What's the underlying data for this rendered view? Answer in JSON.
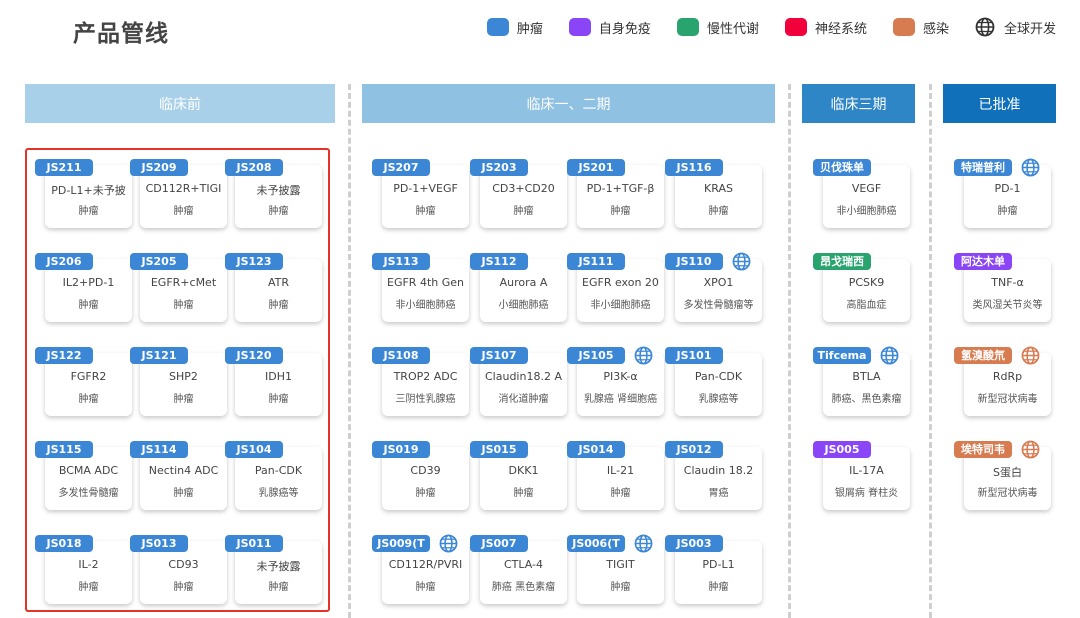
{
  "title": "产品管线",
  "colors": {
    "oncology": "#3b87d6",
    "autoimmune": "#8a45f7",
    "metabolic": "#2aa46e",
    "neuro": "#f2003c",
    "infection": "#d77c50",
    "highlight": "#e5332a",
    "preclinical": "#a9d0e9",
    "phase12": "#8fc1e2",
    "phase3": "#2f86c6",
    "approved": "#1071ba"
  },
  "legend": [
    {
      "label": "肿瘤",
      "color": "#3b87d6"
    },
    {
      "label": "自身免疫",
      "color": "#8a45f7"
    },
    {
      "label": "慢性代谢",
      "color": "#2aa46e"
    },
    {
      "label": "神经系统",
      "color": "#f2003c"
    },
    {
      "label": "感染",
      "color": "#d77c50"
    },
    {
      "label": "全球开发",
      "icon": "globe-icon"
    }
  ],
  "stages": [
    "临床前",
    "临床一、二期",
    "临床三期",
    "已批准"
  ],
  "columns": {
    "preclinical": [
      {
        "code": "JS211",
        "target": "PD-L1+未予披",
        "indication": "肿瘤",
        "color": "#3b87d6",
        "global": false
      },
      {
        "code": "JS209",
        "target": "CD112R+TIGI",
        "indication": "肿瘤",
        "color": "#3b87d6",
        "global": false
      },
      {
        "code": "JS208",
        "target": "未予披露",
        "indication": "肿瘤",
        "color": "#3b87d6",
        "global": false
      },
      {
        "code": "JS206",
        "target": "IL2+PD-1",
        "indication": "肿瘤",
        "color": "#3b87d6",
        "global": false
      },
      {
        "code": "JS205",
        "target": "EGFR+cMet",
        "indication": "肿瘤",
        "color": "#3b87d6",
        "global": false
      },
      {
        "code": "JS123",
        "target": "ATR",
        "indication": "肿瘤",
        "color": "#3b87d6",
        "global": false
      },
      {
        "code": "JS122",
        "target": "FGFR2",
        "indication": "肿瘤",
        "color": "#3b87d6",
        "global": false
      },
      {
        "code": "JS121",
        "target": "SHP2",
        "indication": "肿瘤",
        "color": "#3b87d6",
        "global": false
      },
      {
        "code": "JS120",
        "target": "IDH1",
        "indication": "肿瘤",
        "color": "#3b87d6",
        "global": false
      },
      {
        "code": "JS115",
        "target": "BCMA ADC",
        "indication": "多发性骨髓瘤",
        "color": "#3b87d6",
        "global": false
      },
      {
        "code": "JS114",
        "target": "Nectin4 ADC",
        "indication": "肿瘤",
        "color": "#3b87d6",
        "global": false
      },
      {
        "code": "JS104",
        "target": "Pan-CDK",
        "indication": "乳腺癌等",
        "color": "#3b87d6",
        "global": false
      },
      {
        "code": "JS018",
        "target": "IL-2",
        "indication": "肿瘤",
        "color": "#3b87d6",
        "global": false
      },
      {
        "code": "JS013",
        "target": "CD93",
        "indication": "肿瘤",
        "color": "#3b87d6",
        "global": false
      },
      {
        "code": "JS011",
        "target": "未予披露",
        "indication": "肿瘤",
        "color": "#3b87d6",
        "global": false
      }
    ],
    "phase12": [
      {
        "code": "JS207",
        "target": "PD-1+VEGF",
        "indication": "肿瘤",
        "color": "#3b87d6",
        "global": false
      },
      {
        "code": "JS203",
        "target": "CD3+CD20",
        "indication": "肿瘤",
        "color": "#3b87d6",
        "global": false
      },
      {
        "code": "JS201",
        "target": "PD-1+TGF-β",
        "indication": "肿瘤",
        "color": "#3b87d6",
        "global": false
      },
      {
        "code": "JS116",
        "target": "KRAS",
        "indication": "肿瘤",
        "color": "#3b87d6",
        "global": false
      },
      {
        "code": "JS113",
        "target": "EGFR 4th Gen",
        "indication": "非小细胞肺癌",
        "color": "#3b87d6",
        "global": false
      },
      {
        "code": "JS112",
        "target": "Aurora A",
        "indication": "小细胞肺癌",
        "color": "#3b87d6",
        "global": false
      },
      {
        "code": "JS111",
        "target": "EGFR exon 20",
        "indication": "非小细胞肺癌",
        "color": "#3b87d6",
        "global": false
      },
      {
        "code": "JS110",
        "target": "XPO1",
        "indication": "多发性骨髓瘤等",
        "color": "#3b87d6",
        "global": true
      },
      {
        "code": "JS108",
        "target": "TROP2 ADC",
        "indication": "三阴性乳腺癌",
        "color": "#3b87d6",
        "global": false
      },
      {
        "code": "JS107",
        "target": "Claudin18.2 A",
        "indication": "消化道肿瘤",
        "color": "#3b87d6",
        "global": false
      },
      {
        "code": "JS105",
        "target": "PI3K-α",
        "indication": "乳腺癌 肾细胞癌",
        "color": "#3b87d6",
        "global": true
      },
      {
        "code": "JS101",
        "target": "Pan-CDK",
        "indication": "乳腺癌等",
        "color": "#3b87d6",
        "global": false
      },
      {
        "code": "JS019",
        "target": "CD39",
        "indication": "肿瘤",
        "color": "#3b87d6",
        "global": false
      },
      {
        "code": "JS015",
        "target": "DKK1",
        "indication": "肿瘤",
        "color": "#3b87d6",
        "global": false
      },
      {
        "code": "JS014",
        "target": "IL-21",
        "indication": "肿瘤",
        "color": "#3b87d6",
        "global": false
      },
      {
        "code": "JS012",
        "target": "Claudin 18.2",
        "indication": "胃癌",
        "color": "#3b87d6",
        "global": false
      },
      {
        "code": "JS009(T",
        "target": "CD112R/PVRI",
        "indication": "肿瘤",
        "color": "#3b87d6",
        "global": true
      },
      {
        "code": "JS007",
        "target": "CTLA-4",
        "indication": "肺癌 黑色素瘤",
        "color": "#3b87d6",
        "global": false
      },
      {
        "code": "JS006(T",
        "target": "TIGIT",
        "indication": "肿瘤",
        "color": "#3b87d6",
        "global": true
      },
      {
        "code": "JS003",
        "target": "PD-L1",
        "indication": "肿瘤",
        "color": "#3b87d6",
        "global": false
      }
    ],
    "phase3": [
      {
        "code": "贝伐珠单",
        "target": "VEGF",
        "indication": "非小细胞肺癌",
        "color": "#3b87d6",
        "global": false
      },
      {
        "code": "昂戈瑞西",
        "target": "PCSK9",
        "indication": "高脂血症",
        "color": "#2aa46e",
        "global": false
      },
      {
        "code": "Tifcema",
        "target": "BTLA",
        "indication": "肺癌、黑色素瘤",
        "color": "#3b87d6",
        "global": true
      },
      {
        "code": "JS005",
        "target": "IL-17A",
        "indication": "银屑病 脊柱炎",
        "color": "#8a45f7",
        "global": false
      }
    ],
    "approved": [
      {
        "code": "特瑞普利",
        "target": "PD-1",
        "indication": "肿瘤",
        "color": "#3b87d6",
        "global": true
      },
      {
        "code": "阿达木单",
        "target": "TNF-α",
        "indication": "类风湿关节炎等",
        "color": "#8a45f7",
        "global": false
      },
      {
        "code": "氢溴酸氘",
        "target": "RdRp",
        "indication": "新型冠状病毒",
        "color": "#d77c50",
        "global": true
      },
      {
        "code": "埃特司韦",
        "target": "S蛋白",
        "indication": "新型冠状病毒",
        "color": "#d77c50",
        "global": true
      }
    ]
  }
}
